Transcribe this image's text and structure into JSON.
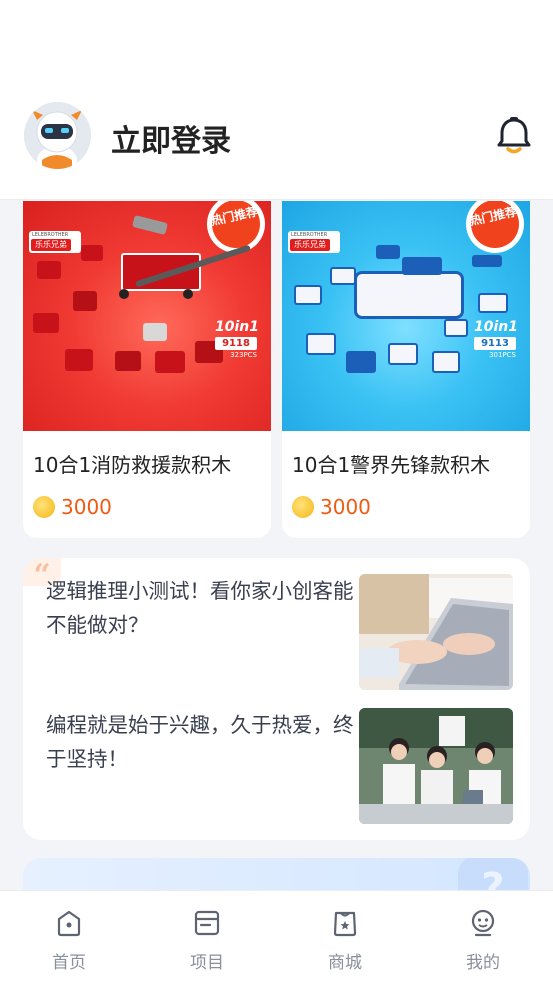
{
  "header": {
    "login_text": "立即登录",
    "avatar_icon": "robot-avatar-icon",
    "notification_icon": "bell-icon",
    "accent_color": "#f5a623"
  },
  "products": [
    {
      "name": "10合1消防救援款积木",
      "price": "3000",
      "brand_en": "LELEBROTHER",
      "brand_cn": "乐乐兄弟",
      "badge": "热门推荐",
      "set_label": "10in1",
      "set_number": "9118",
      "piece_count": "323PCS",
      "image_color": "#e8292b"
    },
    {
      "name": "10合1警界先锋款积木",
      "price": "3000",
      "brand_en": "LELEBROTHER",
      "brand_cn": "乐乐兄弟",
      "badge": "热门推荐",
      "set_label": "10in1",
      "set_number": "9113",
      "piece_count": "301PCS",
      "image_color": "#2fb7ee"
    }
  ],
  "articles": [
    {
      "title": "逻辑推理小测试！看你家小创客能不能做对？"
    },
    {
      "title": "编程就是始于兴趣，久于热爱，终于坚持！"
    }
  ],
  "tabbar": {
    "items": [
      {
        "label": "首页",
        "icon": "home-icon"
      },
      {
        "label": "项目",
        "icon": "project-icon"
      },
      {
        "label": "商城",
        "icon": "shop-icon"
      },
      {
        "label": "我的",
        "icon": "profile-icon"
      }
    ]
  },
  "colors": {
    "price": "#f05a14",
    "tab_inactive": "#8a8f9c",
    "page_bg": "#f3f4f7"
  }
}
